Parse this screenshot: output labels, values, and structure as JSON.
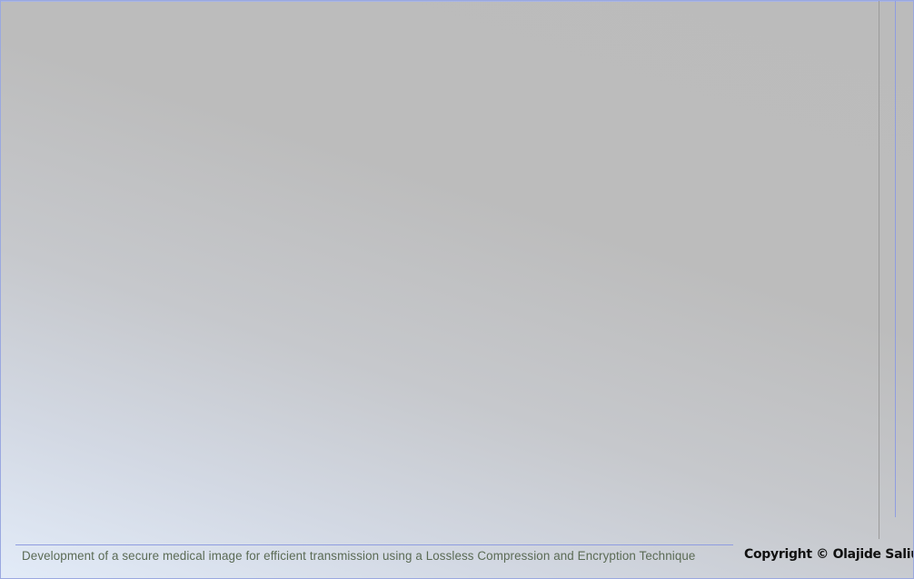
{
  "footer": {
    "project_title": "Development of a secure medical image for efficient transmission using a Lossless Compression and Encryption Technique",
    "copyright": "Copyright © Olajide Saliu"
  },
  "colors": {
    "border_accent": "#9aa8e0",
    "footer_text": "#5b6b55",
    "copyright_text": "#111111"
  }
}
